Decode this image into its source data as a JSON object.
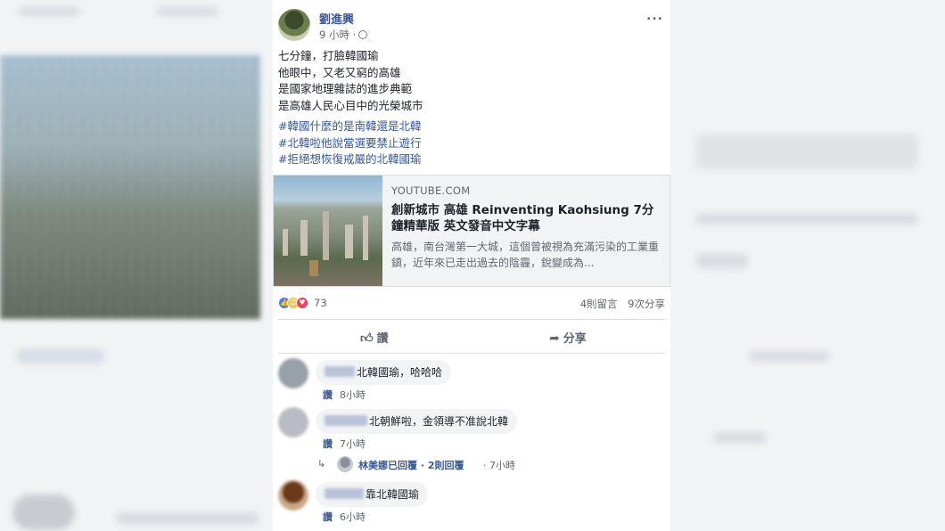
{
  "post": {
    "author": "劉進興",
    "time": "9 小時 ·",
    "body_lines": [
      "七分鐘，打臉韓國瑜",
      "他眼中，又老又窮的高雄",
      "是國家地理雜誌的進步典範",
      "是高雄人民心目中的光榮城市"
    ],
    "hashtags": [
      "#韓國什麼的是南韓還是北韓",
      "#北韓啦他說當選要禁止遊行",
      "#拒絕想恢復戒嚴的北韓國瑜"
    ],
    "more_icon": "..."
  },
  "link_preview": {
    "domain": "YOUTUBE.COM",
    "title": "創新城市 高雄 Reinventing Kaohsiung 7分鐘精華版 英文發音中文字幕",
    "description": "高雄，南台灣第一大城，這個曾被視為充滿污染的工業重鎮，近年來已走出過去的陰霾，銳變成為..."
  },
  "reactions": {
    "icons": [
      "like-reaction-icon",
      "haha-reaction-icon",
      "love-reaction-icon"
    ],
    "count": "73",
    "comments": "4則留言",
    "shares": "9次分享"
  },
  "actions": {
    "like_label": "讚",
    "share_label": "分享"
  },
  "comments": [
    {
      "text": "北韓國瑜，哈哈哈",
      "like": "讚",
      "time": "8小時"
    },
    {
      "text": "北朝鮮啦，金領導不准說北韓",
      "like": "讚",
      "time": "7小時"
    },
    {
      "text": "靠北韓國瑜",
      "like": "讚",
      "time": "6小時"
    }
  ],
  "reply": {
    "text": "林美娜已回覆 · 2則回覆",
    "time": "· 7小時"
  },
  "colors": {
    "link_blue": "#365899",
    "like_blue": "#4a7bf0",
    "haha_yellow": "#f7c33b",
    "love_red": "#f0405a"
  }
}
